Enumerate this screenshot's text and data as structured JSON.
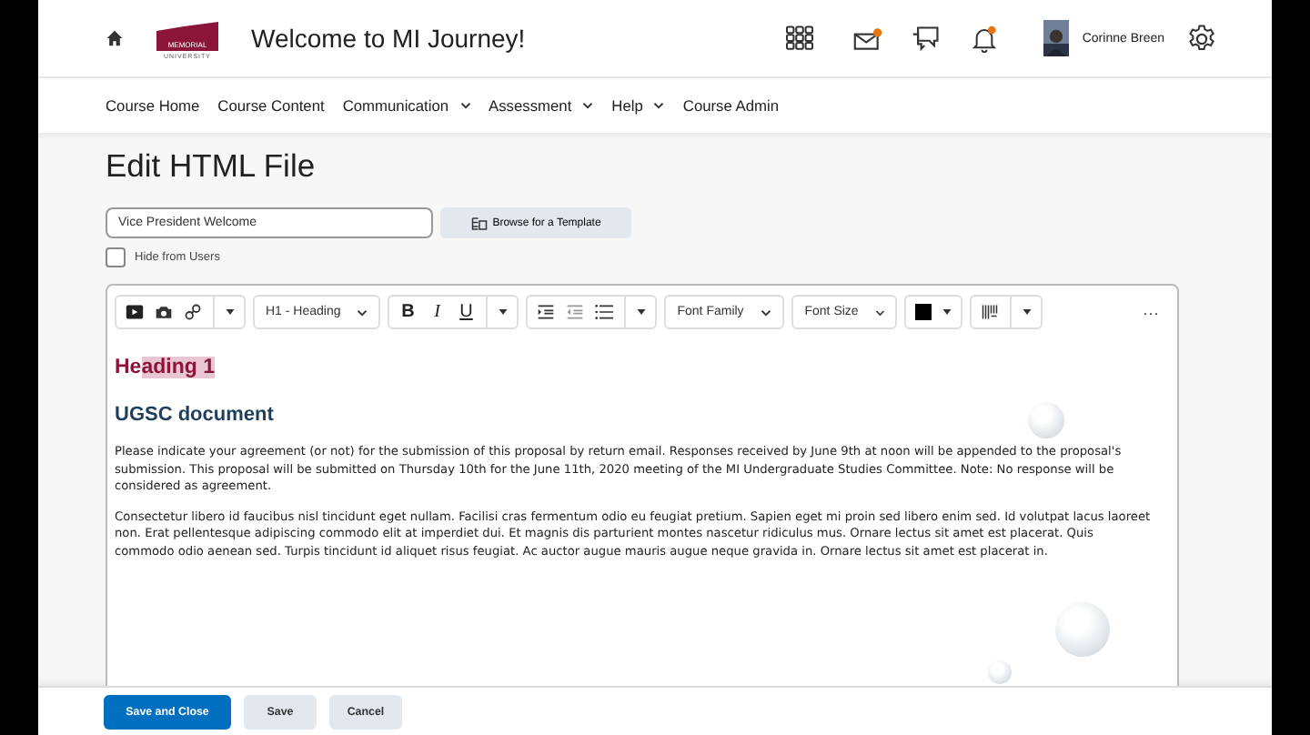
{
  "header": {
    "logo_lines": [
      "MEMORIAL",
      "UNIVERSITY"
    ],
    "title": "Welcome to MI Journey!",
    "notifications": {
      "mail": true,
      "chat": false,
      "bell": true
    },
    "user": "Corinne Breen"
  },
  "nav": [
    {
      "label": "Course Home",
      "dropdown": false
    },
    {
      "label": "Course Content",
      "dropdown": false
    },
    {
      "label": "Communication",
      "dropdown": true
    },
    {
      "label": "Assessment",
      "dropdown": true
    },
    {
      "label": "Help",
      "dropdown": true
    },
    {
      "label": "Course Admin",
      "dropdown": false
    }
  ],
  "page_title": "Edit HTML File",
  "title_field": {
    "value": "Vice President Welcome"
  },
  "template_button": "Browse for a Template",
  "hide_from_users": {
    "label": "Hide from Users",
    "checked": false
  },
  "toolbar": {
    "format": "H1 - Heading",
    "bold": "B",
    "italic": "I",
    "underline": "U",
    "font_family": "Font Family",
    "font_size": "Font Size",
    "more": "···"
  },
  "document": {
    "heading": [
      {
        "text": "He",
        "selected": false
      },
      {
        "text": "ading 1",
        "selected": true
      }
    ],
    "subheading": "UGSC document",
    "paragraphs": [
      "Please indicate your agreement (or not) for the submission of this proposal by return email. Responses received by June 9th at noon will be appended to the proposal's submission. This proposal will be submitted on Thursday 10th for the June 11th, 2020 meeting of the MI Undergraduate Studies Committee. Note: No response will be considered as agreement.",
      "Consectetur libero id faucibus nisl tincidunt eget nullam. Facilisi cras fermentum odio eu feugiat pretium. Sapien eget mi proin sed libero enim sed. Id volutpat lacus laoreet non. Erat pellentesque adipiscing commodo elit at imperdiet dui. Et magnis dis parturient montes nascetur ridiculus mus. Ornare lectus sit amet est placerat. Quis commodo odio aenean sed. Turpis tincidunt id aliquet risus feugiat. Ac auctor augue mauris augue neque gravida in. Ornare lectus sit amet est placerat in."
    ]
  },
  "buttons": [
    {
      "label": "Save and Close",
      "primary": true
    },
    {
      "label": "Save",
      "primary": false
    },
    {
      "label": "Cancel",
      "primary": false
    }
  ]
}
